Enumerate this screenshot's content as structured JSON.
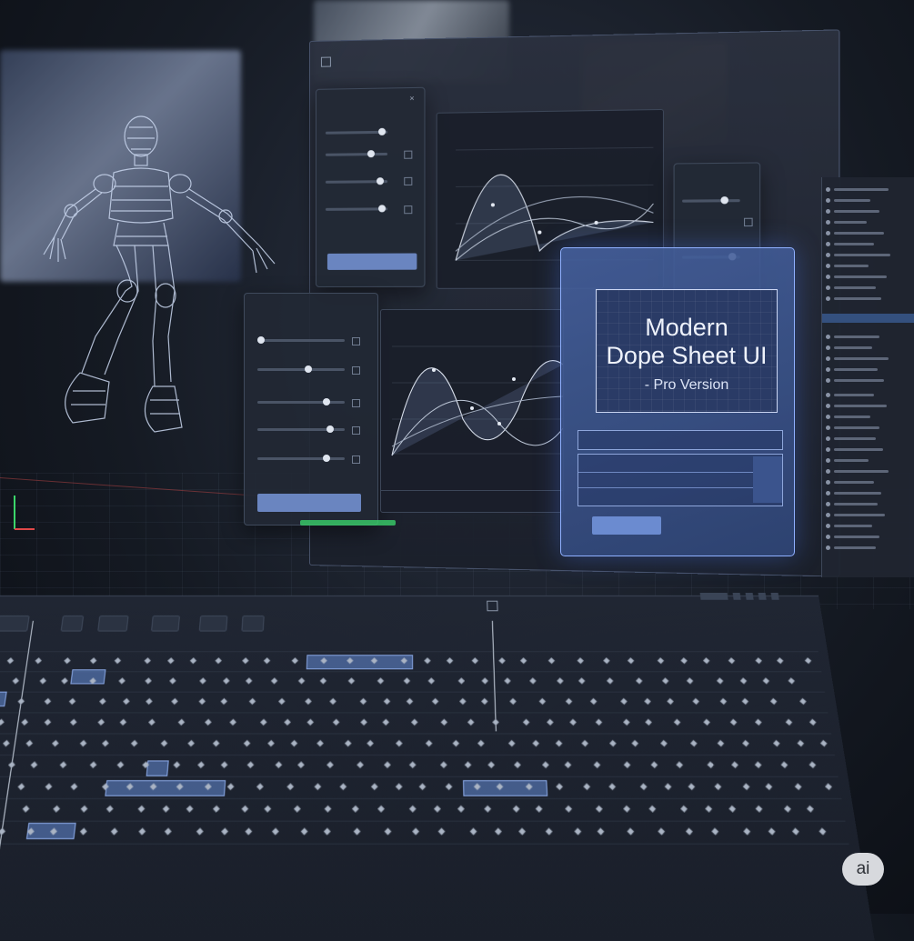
{
  "app": {
    "badge": "ai",
    "title": "Modern Dope Sheet UI",
    "subtitle": "- Pro Version"
  },
  "hero": {
    "title_line1": "Modern",
    "title_line2": "Dope Sheet UI",
    "subtitle": "- Pro Version"
  },
  "colors": {
    "background": "#151a23",
    "panel": "#222834",
    "accent": "#6a85c0",
    "hero_blue": "#4662a0",
    "key_grey": "#aab4c4"
  },
  "icons": {
    "menu": "menu-icon",
    "close": "close-icon",
    "skeleton": "wireframe-figure-icon",
    "axis": "axis-gizmo-icon",
    "badge": "ai-badge"
  }
}
